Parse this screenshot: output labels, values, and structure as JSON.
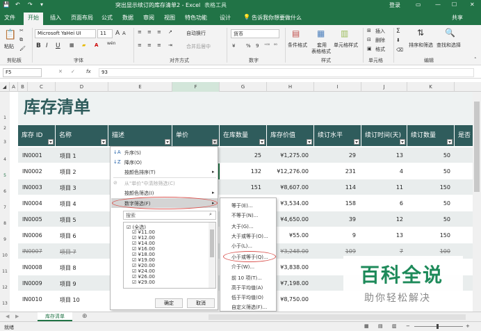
{
  "window": {
    "title": "突出显示续订的库存清单2 - Excel",
    "context_tab": "表格工具",
    "login": "登录",
    "min": "—",
    "restore": "☐",
    "close": "✕"
  },
  "quick_access": {
    "save_icon": "save-icon",
    "undo": "↶",
    "redo": "↷"
  },
  "tabs": [
    "文件",
    "开始",
    "插入",
    "页面布局",
    "公式",
    "数据",
    "审阅",
    "视图",
    "特色功能",
    "设计"
  ],
  "tell_me": "告诉我你想要做什么",
  "share": "共享",
  "ribbon": {
    "paste": "粘贴",
    "font_name": "Microsoft YaHei UI",
    "font_size": "11",
    "grow": "A",
    "shrink": "A",
    "bold": "B",
    "italic": "I",
    "underline": "U",
    "wen": "wén",
    "wrap": "自动换行",
    "merge": "合并后居中",
    "number_format": "货币",
    "currency_symbol": "¥",
    "percent": "%",
    "comma": "9",
    "dec_up": "⁺⁰⁰",
    "dec_down": "⁰⁰",
    "cond_format": "条件格式",
    "table_format_1": "套用",
    "table_format_2": "表格格式",
    "cell_styles": "单元格样式",
    "insert": "插入",
    "delete": "删除",
    "format": "格式",
    "sort_filter": "排序和筛选",
    "find_select": "查找和选择",
    "groups": [
      "剪贴板",
      "字体",
      "对齐方式",
      "数字",
      "样式",
      "单元格",
      "编辑"
    ]
  },
  "formula_bar": {
    "name_box": "F5",
    "fx": "fx",
    "cancel": "✕",
    "confirm": "✓",
    "value": "93"
  },
  "columns": [
    "A",
    "B",
    "C",
    "D",
    "E",
    "F",
    "G",
    "H",
    "I",
    "J",
    "K"
  ],
  "rows": [
    "1",
    "2",
    "3",
    "4",
    "5",
    "6",
    "7",
    "8",
    "9",
    "10",
    "11",
    "12",
    "13"
  ],
  "sheet": {
    "title": "库存清单",
    "headers": [
      "库存 ID",
      "名称",
      "描述",
      "单价",
      "在库数量",
      "库存价值",
      "续订水平",
      "续订时间(天)",
      "续订数量",
      "是否"
    ],
    "data": [
      {
        "id": "IN0001",
        "name": "项目 1",
        "qty": "25",
        "value": "¥1,275.00",
        "level": "29",
        "days": "13",
        "order": "50"
      },
      {
        "id": "IN0002",
        "name": "项目 2",
        "qty": "132",
        "value": "¥12,276.00",
        "level": "231",
        "days": "4",
        "order": "50"
      },
      {
        "id": "IN0003",
        "name": "项目 3",
        "qty": "151",
        "value": "¥8,607.00",
        "level": "114",
        "days": "11",
        "order": "150"
      },
      {
        "id": "IN0004",
        "name": "项目 4",
        "qty": "",
        "value": "¥3,534.00",
        "level": "158",
        "days": "6",
        "order": "50"
      },
      {
        "id": "IN0005",
        "name": "项目 5",
        "qty": "",
        "value": "¥4,650.00",
        "level": "39",
        "days": "12",
        "order": "50"
      },
      {
        "id": "IN0006",
        "name": "项目 6",
        "qty": "",
        "value": "¥55.00",
        "level": "9",
        "days": "13",
        "order": "150"
      },
      {
        "id": "IN0007",
        "name": "项目 7",
        "qty": "",
        "value": "¥3,248.00",
        "level": "109",
        "days": "7",
        "order": "100"
      },
      {
        "id": "IN0008",
        "name": "项目 8",
        "qty": "",
        "value": "¥3,838.00",
        "level": "",
        "days": "",
        "order": ""
      },
      {
        "id": "IN0009",
        "name": "项目 9",
        "qty": "",
        "value": "¥7,198.00",
        "level": "",
        "days": "",
        "order": ""
      },
      {
        "id": "IN0010",
        "name": "项目 10",
        "qty": "",
        "value": "¥8,750.00",
        "level": "",
        "days": "",
        "order": ""
      }
    ]
  },
  "filter_menu": {
    "sort_asc": "升序(S)",
    "sort_desc": "降序(O)",
    "sort_color": "按颜色排序(T)",
    "clear": "从\"单价\"中清除筛选(C)",
    "filter_color": "按颜色筛选(I)",
    "number_filter": "数字筛选(F)",
    "search_placeholder": "搜索",
    "items": [
      "(全选)",
      "¥11.00",
      "¥12.00",
      "¥14.00",
      "¥16.00",
      "¥18.00",
      "¥19.00",
      "¥20.00",
      "¥24.00",
      "¥26.00",
      "¥29.00"
    ],
    "ok": "确定",
    "cancel": "取消"
  },
  "number_submenu": [
    "等于(E)...",
    "不等于(N)...",
    "大于(G)...",
    "大于或等于(O)...",
    "小于(L)...",
    "小于或等于(Q)...",
    "介于(W)...",
    "前 10 项(T)...",
    "高于平均值(A)",
    "低于平均值(O)",
    "自定义筛选(F)..."
  ],
  "sheet_tab": "库存清单",
  "status": "就绪",
  "watermark": {
    "line1": "百科全说",
    "line2": "助你轻松解决"
  },
  "colors": {
    "excel_green": "#217346",
    "header_teal": "#2f5c5c",
    "band": "#e9eded",
    "highlight_red": "#d9534f"
  }
}
